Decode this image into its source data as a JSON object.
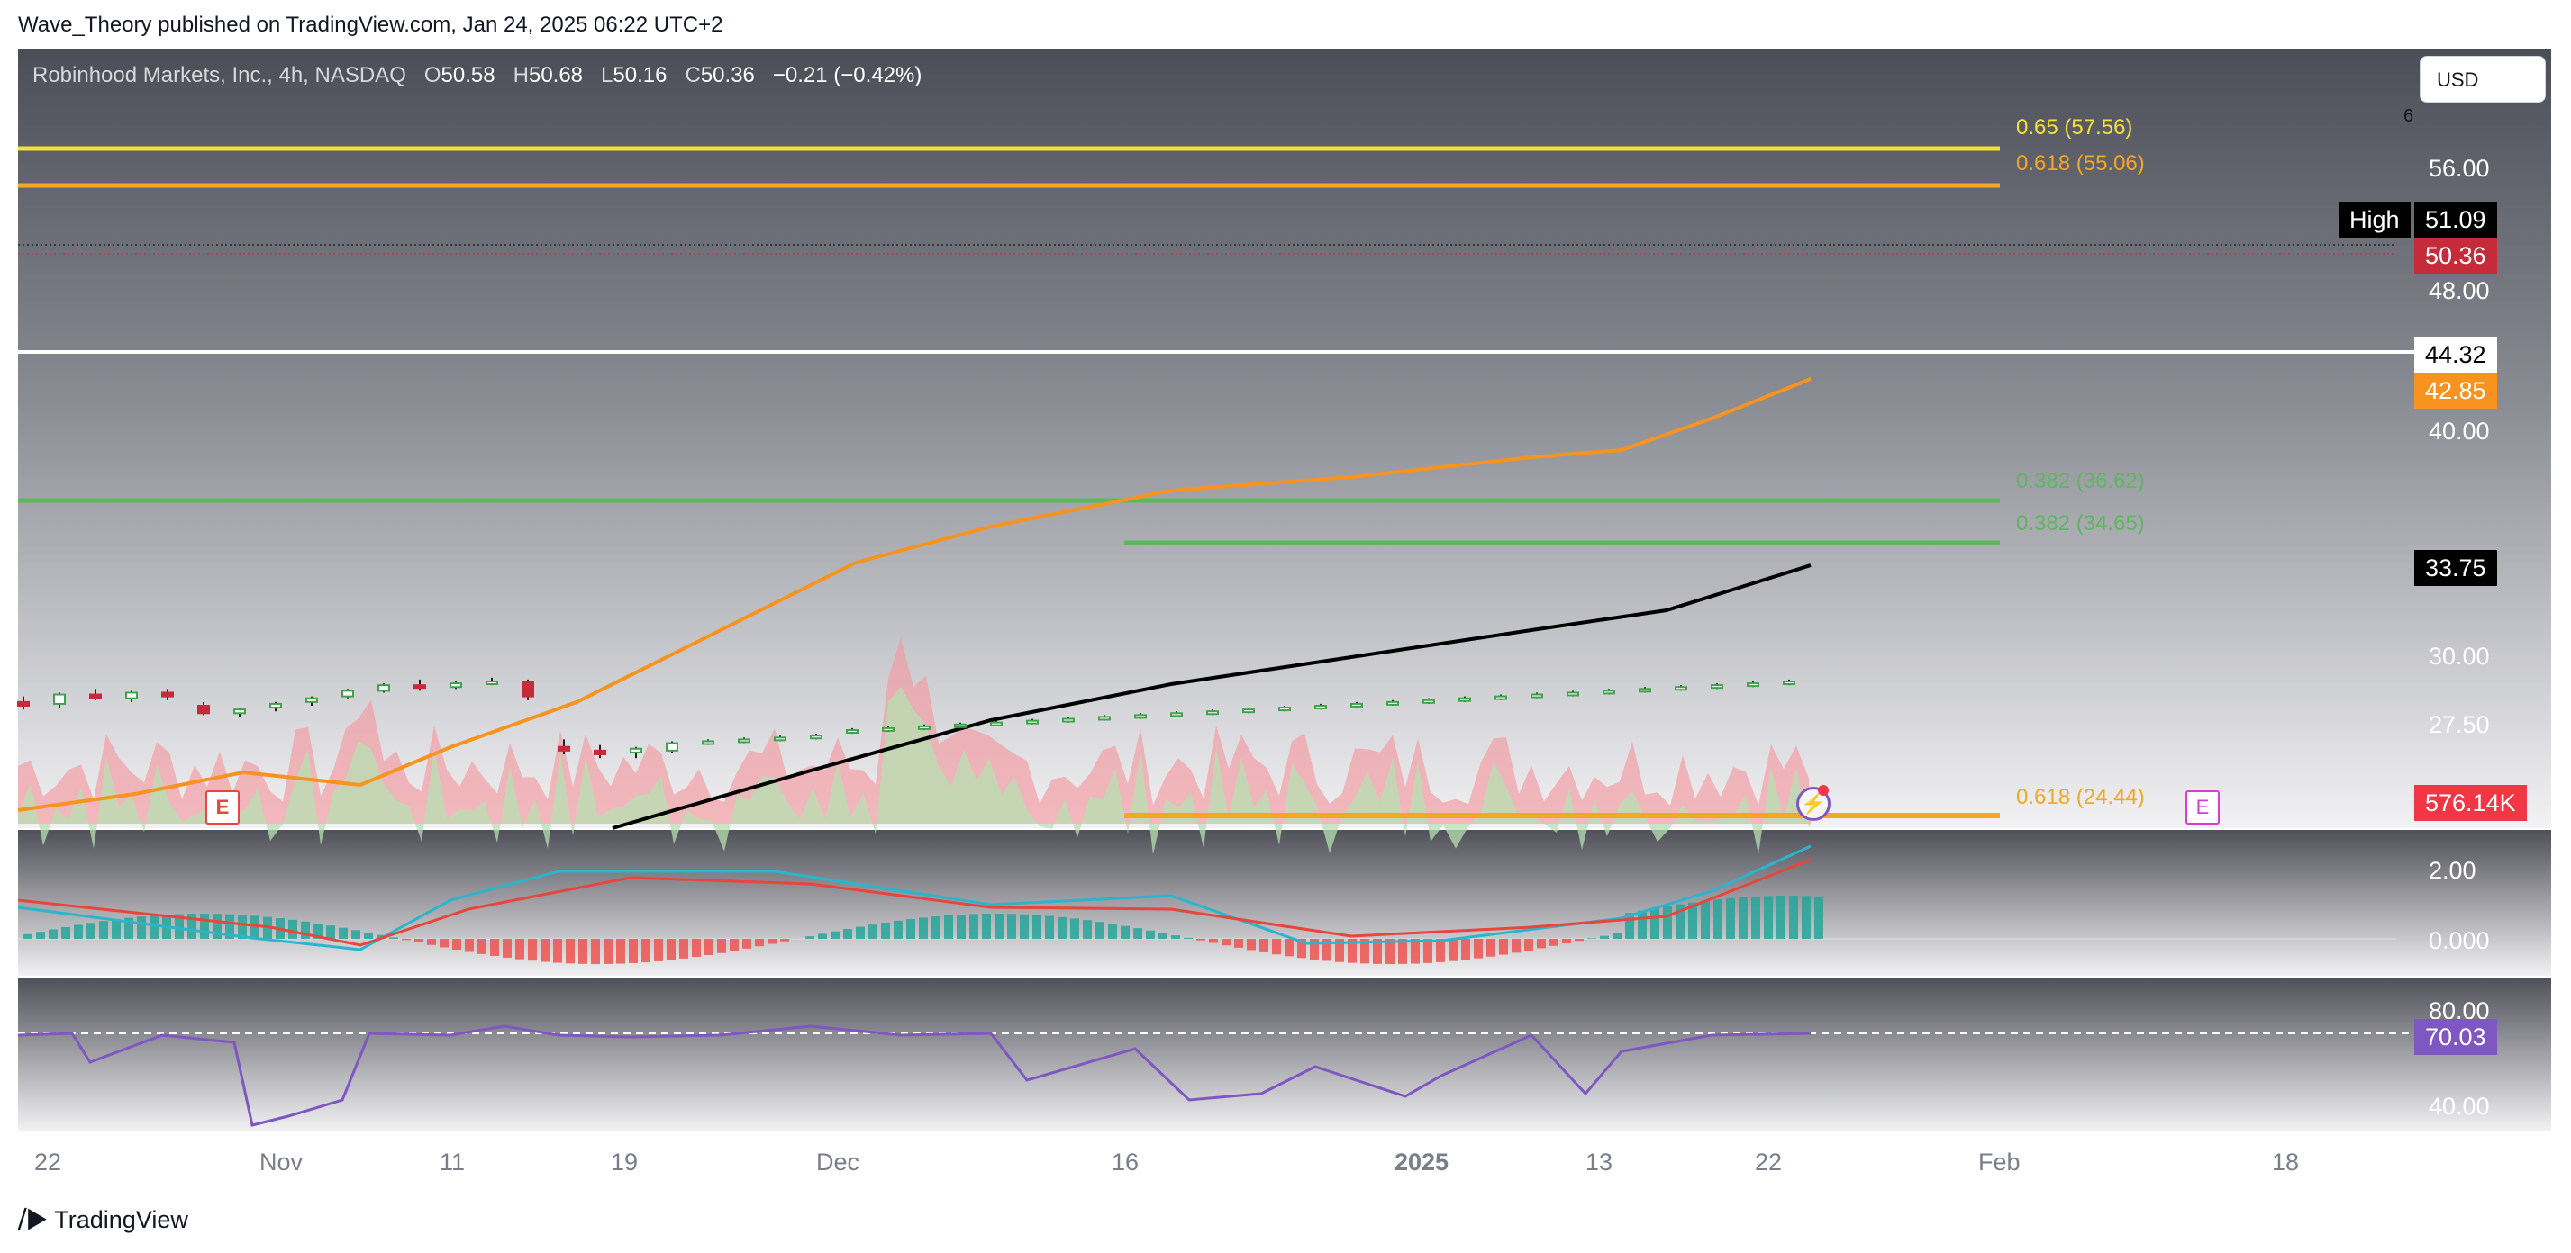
{
  "publisher": "Wave_Theory published on TradingView.com, Jan 24, 2025 06:22 UTC+2",
  "legend": {
    "symbol": "Robinhood Markets, Inc., 4h, NASDAQ",
    "open_label": "O",
    "open": "50.58",
    "high_label": "H",
    "high": "50.68",
    "low_label": "L",
    "low": "50.16",
    "close_label": "C",
    "close": "50.36",
    "change": "−0.21 (−0.42%)"
  },
  "currency_button": "USD",
  "top_marker": "6",
  "price_axis": [
    "56.00",
    "48.00",
    "40.00",
    "30.00",
    "27.50"
  ],
  "price_tags": {
    "high_label": "High",
    "high_value": "51.09",
    "last_price": "50.36",
    "resistance": "44.32",
    "ema50": "42.85",
    "ema200": "33.75",
    "volume": "576.14K"
  },
  "fib_levels": [
    {
      "label": "0.65 (57.56)",
      "price": 57.56,
      "color": "#f5e03a"
    },
    {
      "label": "0.618 (55.06)",
      "price": 55.06,
      "color": "#f5a623"
    },
    {
      "label": "0.382 (36.62)",
      "price": 36.62,
      "color": "#5cb85c"
    },
    {
      "label": "0.382 (34.65)",
      "price": 34.65,
      "color": "#5cb85c"
    },
    {
      "label": "0.618 (24.44)",
      "price": 24.44,
      "color": "#f5a623"
    }
  ],
  "macd_axis": [
    "2.00",
    "0.000"
  ],
  "rsi_axis": [
    "80.00",
    "40.00"
  ],
  "rsi_value": "70.03",
  "time_axis": [
    "22",
    "Nov",
    "11",
    "19",
    "Dec",
    "16",
    "2025",
    "13",
    "22",
    "Feb",
    "18"
  ],
  "earnings_marker": "E",
  "logo_text": "TradingView",
  "colors": {
    "up": "#26a69a",
    "down": "#ef5350",
    "ema50": "#f7931e",
    "ema200": "#000000",
    "macd": "#2bb5cc",
    "signal": "#e8453c",
    "rsi": "#7e57c2",
    "high_tag": "#000000",
    "last_tag": "#c62b3a",
    "vol_tag": "#f23645",
    "rsi_tag": "#7e57c2"
  },
  "chart_data": {
    "type": "candlestick",
    "title": "Robinhood Markets, Inc., 4h, NASDAQ",
    "ylim": [
      21.5,
      60
    ],
    "candles": [
      {
        "o": 27.6,
        "h": 27.9,
        "l": 27.2,
        "c": 27.4
      },
      {
        "o": 27.5,
        "h": 28.1,
        "l": 27.3,
        "c": 28.0
      },
      {
        "o": 28.0,
        "h": 28.3,
        "l": 27.7,
        "c": 27.8
      },
      {
        "o": 27.8,
        "h": 28.2,
        "l": 27.6,
        "c": 28.1
      },
      {
        "o": 28.1,
        "h": 28.3,
        "l": 27.7,
        "c": 27.9
      },
      {
        "o": 27.4,
        "h": 27.6,
        "l": 26.9,
        "c": 27.0
      },
      {
        "o": 27.0,
        "h": 27.3,
        "l": 26.8,
        "c": 27.2
      },
      {
        "o": 27.3,
        "h": 27.6,
        "l": 27.1,
        "c": 27.5
      },
      {
        "o": 27.6,
        "h": 27.9,
        "l": 27.4,
        "c": 27.8
      },
      {
        "o": 27.9,
        "h": 28.3,
        "l": 27.8,
        "c": 28.2
      },
      {
        "o": 28.2,
        "h": 28.6,
        "l": 28.1,
        "c": 28.5
      },
      {
        "o": 28.5,
        "h": 28.8,
        "l": 28.2,
        "c": 28.4
      },
      {
        "o": 28.4,
        "h": 28.7,
        "l": 28.3,
        "c": 28.6
      },
      {
        "o": 28.6,
        "h": 28.9,
        "l": 28.5,
        "c": 28.7
      },
      {
        "o": 28.7,
        "h": 28.8,
        "l": 27.7,
        "c": 27.9
      },
      {
        "o": 25.2,
        "h": 25.6,
        "l": 24.8,
        "c": 25.0
      },
      {
        "o": 25.0,
        "h": 25.3,
        "l": 24.6,
        "c": 24.8
      },
      {
        "o": 24.9,
        "h": 25.2,
        "l": 24.6,
        "c": 25.1
      },
      {
        "o": 25.0,
        "h": 25.5,
        "l": 24.9,
        "c": 25.4
      },
      {
        "o": 25.4,
        "h": 25.6,
        "l": 25.3,
        "c": 25.5
      },
      {
        "o": 25.5,
        "h": 25.7,
        "l": 25.4,
        "c": 25.6
      },
      {
        "o": 25.6,
        "h": 25.8,
        "l": 25.5,
        "c": 25.7
      },
      {
        "o": 25.7,
        "h": 25.9,
        "l": 25.6,
        "c": 25.8
      },
      {
        "o": 26.0,
        "h": 26.2,
        "l": 25.9,
        "c": 26.1
      },
      {
        "o": 26.1,
        "h": 26.3,
        "l": 26.0,
        "c": 26.2
      },
      {
        "o": 26.2,
        "h": 26.4,
        "l": 26.1,
        "c": 26.3
      },
      {
        "o": 26.3,
        "h": 26.5,
        "l": 26.2,
        "c": 26.4
      },
      {
        "o": 26.4,
        "h": 26.6,
        "l": 26.3,
        "c": 26.5
      },
      {
        "o": 26.5,
        "h": 26.7,
        "l": 26.4,
        "c": 26.6
      },
      {
        "o": 26.6,
        "h": 26.8,
        "l": 26.5,
        "c": 26.7
      },
      {
        "o": 26.7,
        "h": 26.9,
        "l": 26.6,
        "c": 26.8
      },
      {
        "o": 26.8,
        "h": 27.0,
        "l": 26.7,
        "c": 26.9
      },
      {
        "o": 26.9,
        "h": 27.1,
        "l": 26.8,
        "c": 27.0
      },
      {
        "o": 27.0,
        "h": 27.2,
        "l": 26.9,
        "c": 27.1
      },
      {
        "o": 27.1,
        "h": 27.3,
        "l": 27.0,
        "c": 27.2
      },
      {
        "o": 27.2,
        "h": 27.4,
        "l": 27.1,
        "c": 27.3
      },
      {
        "o": 27.3,
        "h": 27.5,
        "l": 27.2,
        "c": 27.4
      },
      {
        "o": 27.4,
        "h": 27.6,
        "l": 27.3,
        "c": 27.5
      },
      {
        "o": 27.5,
        "h": 27.7,
        "l": 27.4,
        "c": 27.6
      },
      {
        "o": 27.6,
        "h": 27.8,
        "l": 27.5,
        "c": 27.7
      },
      {
        "o": 27.7,
        "h": 27.9,
        "l": 27.6,
        "c": 27.8
      },
      {
        "o": 27.8,
        "h": 28.0,
        "l": 27.7,
        "c": 27.9
      },
      {
        "o": 27.9,
        "h": 28.1,
        "l": 27.8,
        "c": 28.0
      },
      {
        "o": 28.0,
        "h": 28.2,
        "l": 27.9,
        "c": 28.1
      },
      {
        "o": 28.1,
        "h": 28.3,
        "l": 28.0,
        "c": 28.2
      },
      {
        "o": 28.2,
        "h": 28.4,
        "l": 28.1,
        "c": 28.3
      },
      {
        "o": 28.3,
        "h": 28.5,
        "l": 28.2,
        "c": 28.4
      },
      {
        "o": 28.4,
        "h": 28.6,
        "l": 28.3,
        "c": 28.5
      },
      {
        "o": 28.5,
        "h": 28.7,
        "l": 28.4,
        "c": 28.6
      },
      {
        "o": 28.6,
        "h": 28.8,
        "l": 28.5,
        "c": 28.7
      }
    ],
    "series": [
      {
        "name": "",
        "type": "ema50",
        "last": 42.85
      },
      {
        "name": "",
        "type": "ema200",
        "last": 33.75
      }
    ],
    "horizontal_lines": [
      44.32,
      36.62,
      34.65
    ],
    "x_tick_labels": [
      "22",
      "Nov",
      "11",
      "19",
      "Dec",
      "16",
      "2025",
      "13",
      "22",
      "Feb",
      "18"
    ]
  }
}
